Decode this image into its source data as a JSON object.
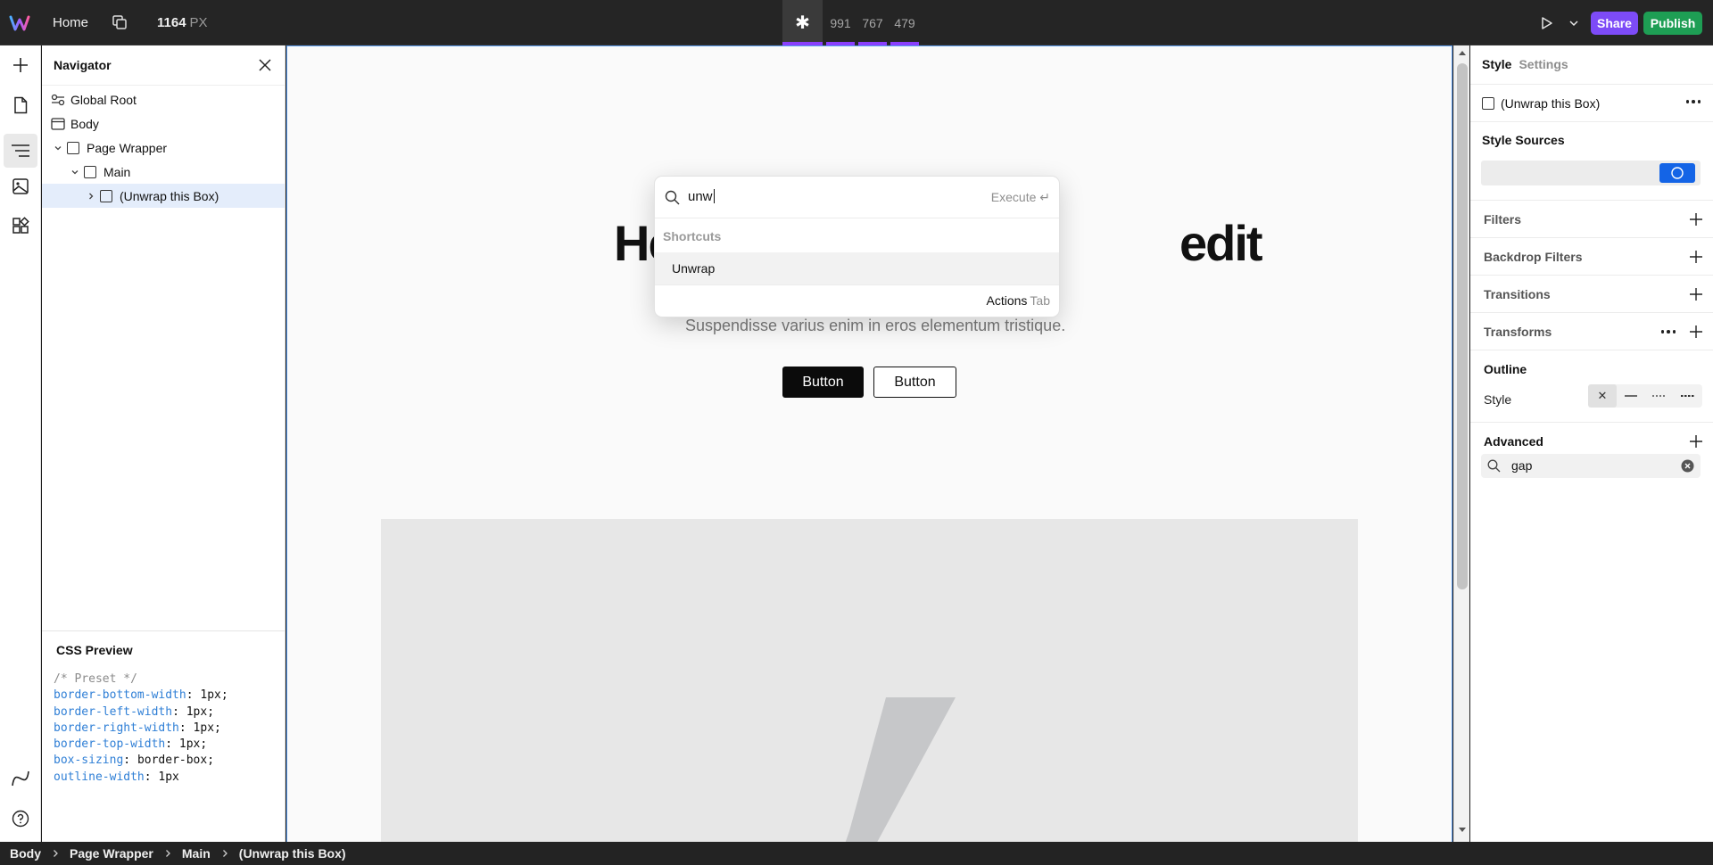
{
  "topbar": {
    "home_label": "Home",
    "width_value": "1164",
    "width_unit": "PX",
    "breakpoints": [
      "991",
      "767",
      "479"
    ],
    "share_label": "Share",
    "publish_label": "Publish"
  },
  "navigator": {
    "title": "Navigator",
    "items": [
      {
        "label": "Global Root"
      },
      {
        "label": "Body"
      },
      {
        "label": "Page Wrapper"
      },
      {
        "label": "Main"
      },
      {
        "label": "(Unwrap this Box)"
      }
    ]
  },
  "css_preview": {
    "title": "CSS Preview",
    "comment": "/* Preset */",
    "lines": [
      {
        "prop": "border-bottom-width",
        "value": "1px"
      },
      {
        "prop": "border-left-width",
        "value": "1px"
      },
      {
        "prop": "border-right-width",
        "value": "1px"
      },
      {
        "prop": "border-top-width",
        "value": "1px"
      },
      {
        "prop": "box-sizing",
        "value": "border-box"
      },
      {
        "prop": "outline-width",
        "value": "1px"
      }
    ]
  },
  "canvas": {
    "hero_left": "He",
    "hero_right": "edit",
    "subtitle": "Suspendisse varius enim in eros elementum tristique.",
    "button_primary": "Button",
    "button_secondary": "Button"
  },
  "command_palette": {
    "query": "unw",
    "execute_label": "Execute ↵",
    "section_label": "Shortcuts",
    "item_label": "Unwrap",
    "footer_label": "Actions",
    "footer_key": "Tab"
  },
  "style_panel": {
    "tab_style": "Style",
    "tab_settings": "Settings",
    "selected_element": "(Unwrap this Box)",
    "style_sources_label": "Style Sources",
    "sections": [
      "Filters",
      "Backdrop Filters",
      "Transitions",
      "Transforms"
    ],
    "outline_label": "Outline",
    "outline_style_label": "Style",
    "advanced_label": "Advanced",
    "advanced_search_value": "gap"
  },
  "breadcrumb": [
    "Body",
    "Page Wrapper",
    "Main",
    "(Unwrap this Box)"
  ],
  "colors": {
    "accent_purple": "#7d4bf7",
    "publish_green": "#1e9e54",
    "selection_blue": "#1464e6"
  }
}
